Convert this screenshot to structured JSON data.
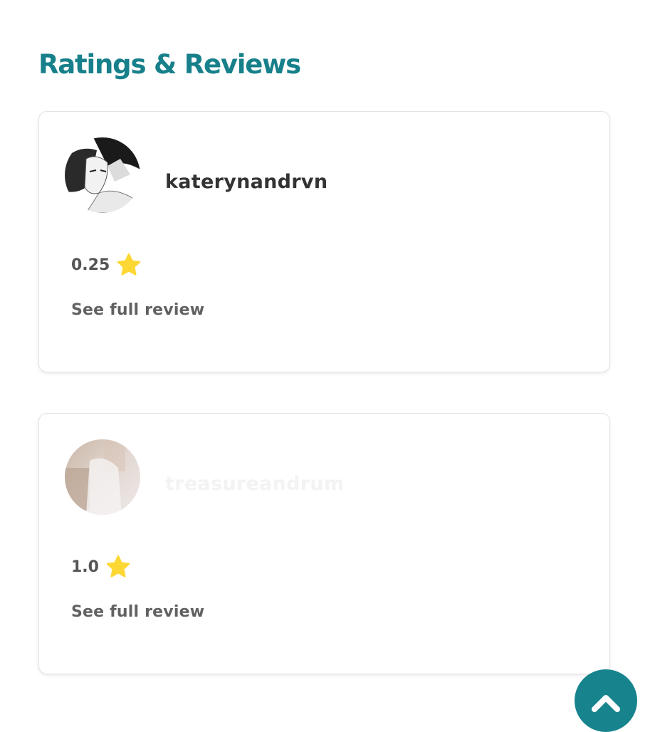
{
  "section": {
    "title": "Ratings & Reviews"
  },
  "reviews": [
    {
      "username": "katerynandrvn",
      "rating": "0.25",
      "link_label": "See full review"
    },
    {
      "username": "treasureandrum",
      "rating": "1.0",
      "link_label": "See full review"
    }
  ],
  "colors": {
    "accent": "#17808a",
    "star": "#fdd835",
    "scroll_button": "#17848d"
  },
  "icons": {
    "rating": "star-icon",
    "scroll": "chevron-up-icon"
  }
}
